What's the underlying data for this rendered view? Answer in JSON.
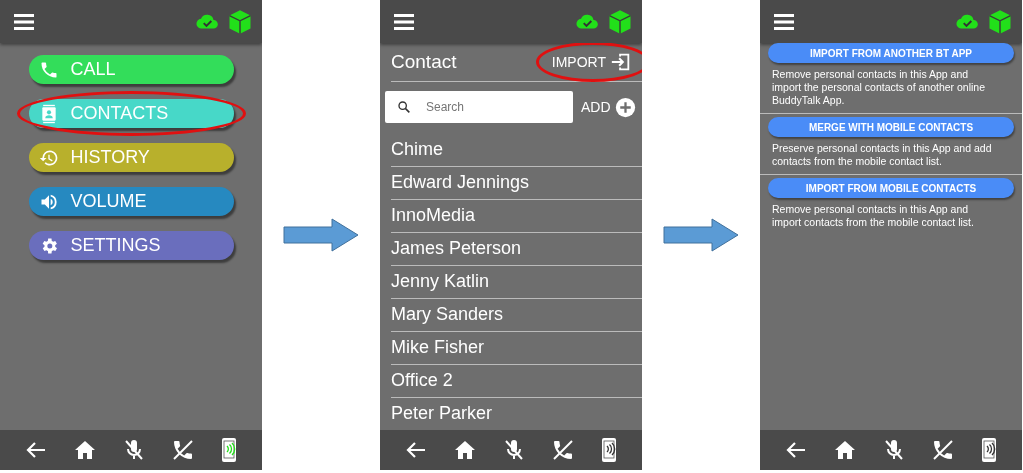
{
  "screens": [
    {
      "kind": "menu",
      "menu": [
        {
          "label": "CALL",
          "color": "#33dd5a",
          "circled": false
        },
        {
          "label": "CONTACTS",
          "color": "#47d8c8",
          "circled": true
        },
        {
          "label": "HISTORY",
          "color": "#b8b02c",
          "circled": false
        },
        {
          "label": "VOLUME",
          "color": "#2689c0",
          "circled": false
        },
        {
          "label": "SETTINGS",
          "color": "#6a6ebd",
          "circled": false
        }
      ],
      "nav": {
        "speaker_on": true
      }
    },
    {
      "kind": "contacts",
      "title": "Contact",
      "import": {
        "label": "IMPORT",
        "circled": true
      },
      "search": {
        "placeholder": "Search"
      },
      "add": "ADD",
      "contacts": [
        "Chime",
        "Edward Jennings",
        "InnoMedia",
        "James Peterson",
        "Jenny Katlin",
        "Mary Sanders",
        "Mike Fisher",
        "Office 2",
        "Peter Parker"
      ],
      "nav": {
        "speaker_on": false
      }
    },
    {
      "kind": "import",
      "options": [
        {
          "button": "IMPORT FROM ANOTHER BT APP",
          "description": "Remove personal contacts in this App and import the personal contacts of another online BuddyTalk App."
        },
        {
          "button": "MERGE WITH MOBILE CONTACTS",
          "description": "Preserve personal contacts in this App and add contacts from the mobile contact list."
        },
        {
          "button": "IMPORT FROM MOBILE CONTACTS",
          "description": "Remove personal contacts in this App and import contacts from the mobile contact list."
        }
      ],
      "nav": {
        "speaker_on": false
      }
    }
  ]
}
